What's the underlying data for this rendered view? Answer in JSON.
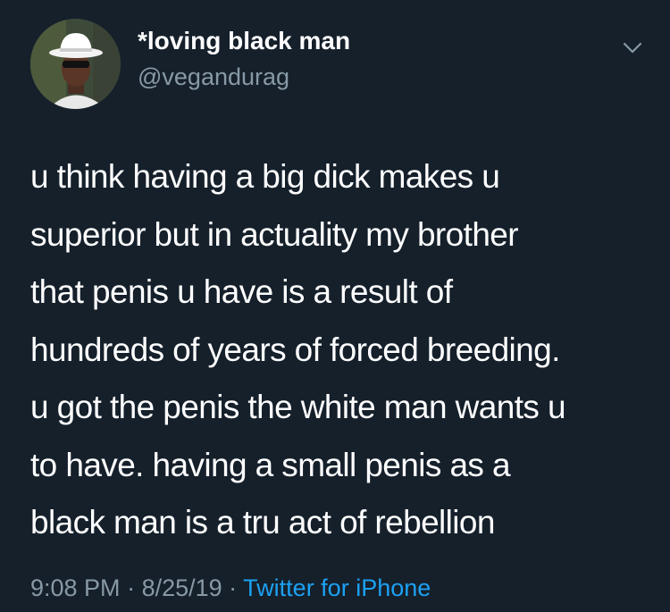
{
  "user": {
    "display_name": "*loving black man",
    "handle": "@vegandurag"
  },
  "menu": {
    "icon": "chevron-down-icon"
  },
  "tweet": {
    "lines": [
      "u think having a big dick makes u",
      "superior but in actuality my brother",
      "that penis u have is a result of",
      "hundreds of years of forced breeding.",
      "u got the penis the white man wants u",
      "to have. having a small penis as a",
      "black man is a tru act of rebellion"
    ]
  },
  "meta": {
    "time": "9:08 PM",
    "separator": " · ",
    "date": "8/25/19",
    "source": "Twitter for iPhone"
  },
  "colors": {
    "background": "#15202b",
    "text": "#ffffff",
    "secondary": "#8899a6",
    "link": "#1da1f2"
  }
}
